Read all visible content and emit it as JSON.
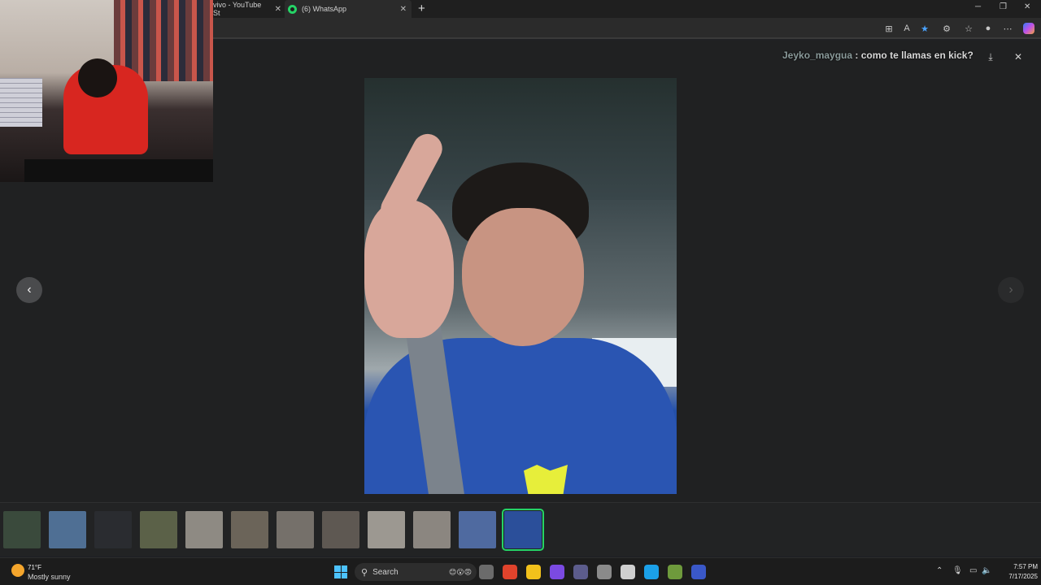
{
  "browser": {
    "tabs": [
      {
        "label": "vivo - YouTube St",
        "active": false
      },
      {
        "label": "(6) WhatsApp",
        "active": true
      }
    ],
    "new_tab_symbol": "+",
    "window_controls": {
      "minimize": "─",
      "restore": "❐",
      "close": "✕"
    },
    "toolbar_icons": [
      "app-grid-icon",
      "read-aloud-icon",
      "favorite-star-icon",
      "extensions-icon",
      "favorites-icon",
      "profile-icon",
      "more-icon",
      "copilot-icon"
    ]
  },
  "viewer": {
    "chat_overlay": {
      "user": "Jeyko_maygua",
      "separator": " : ",
      "message": "como te llamas en kick?"
    },
    "prev_symbol": "‹",
    "next_symbol": "›",
    "tools": {
      "download": "⤓",
      "close": "✕"
    },
    "thumbnails": [
      {
        "color": "#3a4a3c"
      },
      {
        "color": "#4f6f94"
      },
      {
        "color": "#2a2c30"
      },
      {
        "color": "#5b6148"
      },
      {
        "color": "#8e8a83"
      },
      {
        "color": "#6b6459"
      },
      {
        "color": "#75706a"
      },
      {
        "color": "#5e5852"
      },
      {
        "color": "#9c9891"
      },
      {
        "color": "#8b8680"
      },
      {
        "color": "#4f6aa0"
      },
      {
        "color": "#2b4f9a",
        "active": true
      }
    ]
  },
  "taskbar": {
    "weather": {
      "temp": "71°F",
      "desc": "Mostly sunny"
    },
    "search_label": "Search",
    "search_emoji": "😊😮😡",
    "clock": {
      "time": "7:57 PM",
      "date": "7/17/2025"
    },
    "tray": {
      "chevron": "⌃",
      "mic": "🎙",
      "display": "▭",
      "volume": "🔈"
    },
    "apps": [
      "#6b6b6b",
      "#e0432c",
      "#f2c11b",
      "#7b4ae2",
      "#5c5c8c",
      "#8a8a8a",
      "#cfcfcf",
      "#1ba0e8",
      "#6e9a3c",
      "#3a58c8"
    ]
  },
  "colors": {
    "accent": "#25d366",
    "background": "#202124"
  }
}
